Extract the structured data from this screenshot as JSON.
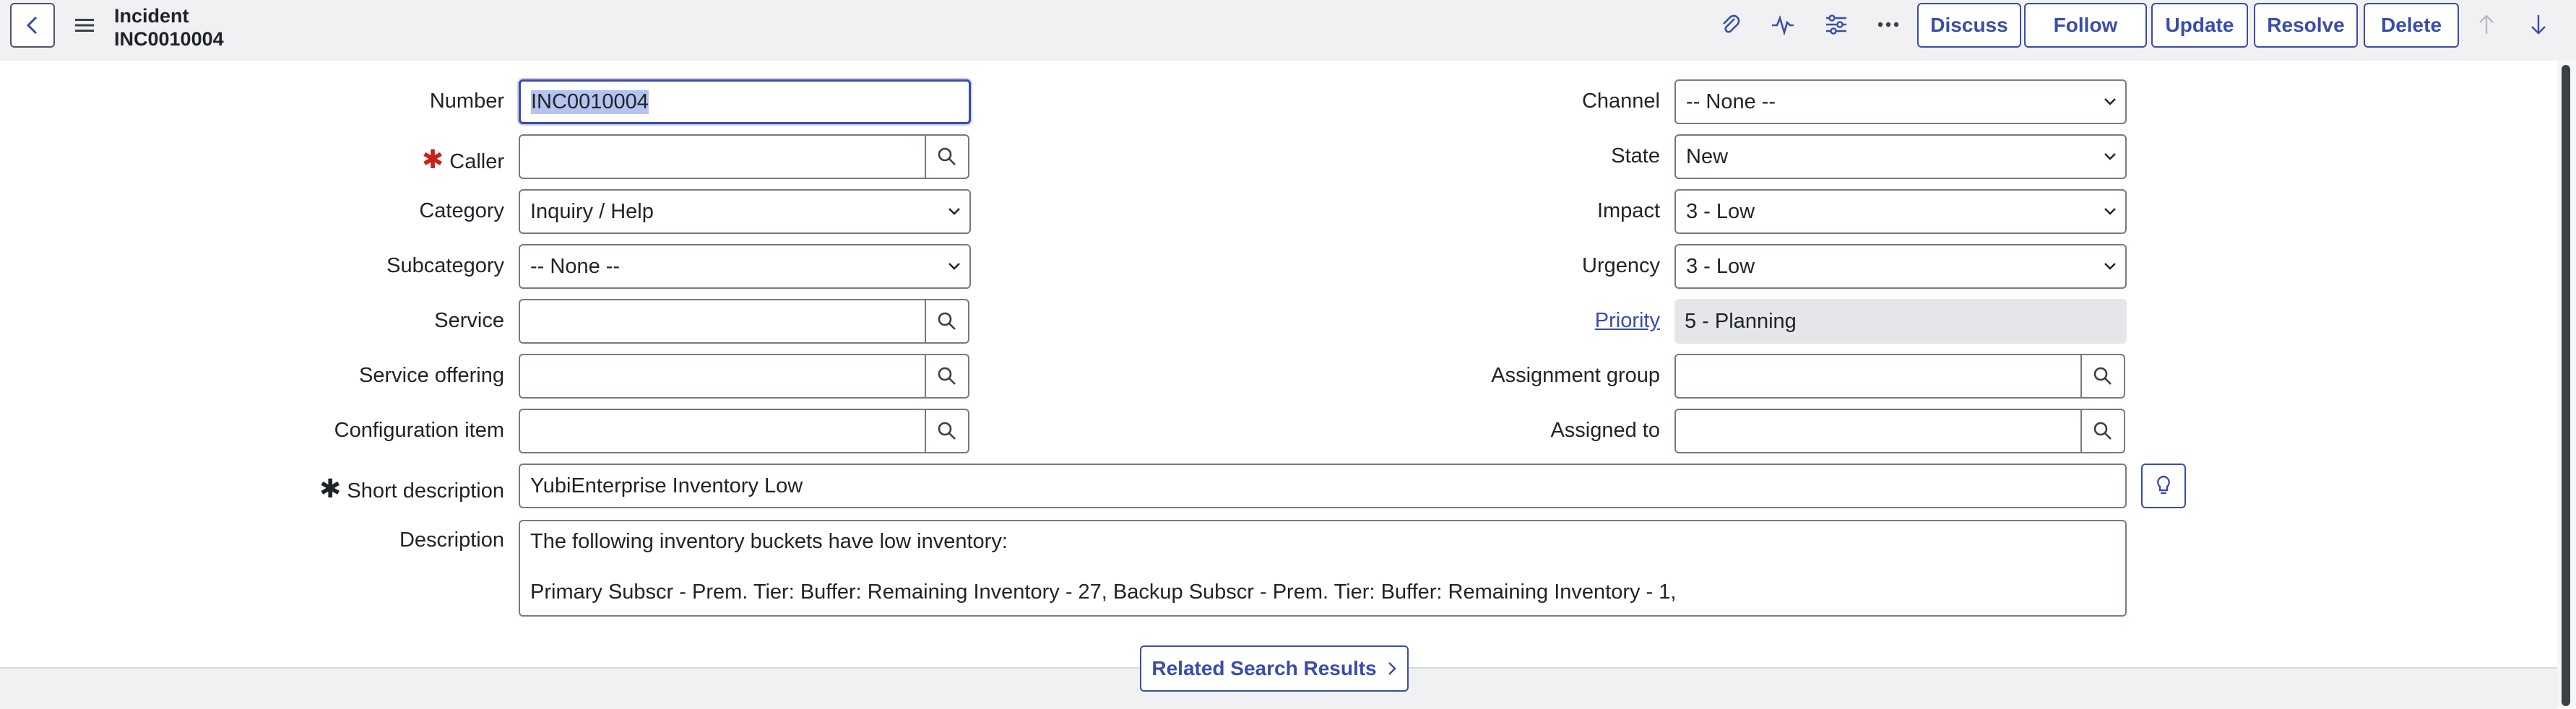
{
  "header": {
    "title": "Incident",
    "number": "INC0010004",
    "buttons": {
      "discuss": "Discuss",
      "follow": "Follow",
      "update": "Update",
      "resolve": "Resolve",
      "delete": "Delete"
    },
    "icons": [
      "back-icon",
      "hamburger-icon",
      "attachment-icon",
      "activity-icon",
      "settings-icon",
      "more-icon",
      "arrow-up-icon",
      "arrow-down-icon"
    ]
  },
  "form": {
    "left": {
      "number": {
        "label": "Number",
        "value": "INC0010004"
      },
      "caller": {
        "label": "Caller",
        "value": ""
      },
      "category": {
        "label": "Category",
        "value": "Inquiry / Help"
      },
      "subcategory": {
        "label": "Subcategory",
        "value": "-- None --"
      },
      "service": {
        "label": "Service",
        "value": ""
      },
      "service_offering": {
        "label": "Service offering",
        "value": ""
      },
      "configuration_item": {
        "label": "Configuration item",
        "value": ""
      }
    },
    "right": {
      "channel": {
        "label": "Channel",
        "value": "-- None --"
      },
      "state": {
        "label": "State",
        "value": "New"
      },
      "impact": {
        "label": "Impact",
        "value": "3 - Low"
      },
      "urgency": {
        "label": "Urgency",
        "value": "3 - Low"
      },
      "priority": {
        "label": "Priority",
        "value": "5 - Planning"
      },
      "assignment_group": {
        "label": "Assignment group",
        "value": ""
      },
      "assigned_to": {
        "label": "Assigned to",
        "value": ""
      }
    },
    "short_description": {
      "label": "Short description",
      "value": "YubiEnterprise Inventory Low"
    },
    "description": {
      "label": "Description",
      "line1": "The following inventory buckets have low inventory:",
      "line2": "Primary Subscr - Prem. Tier: Buffer: Remaining Inventory - 27, Backup Subscr - Prem. Tier: Buffer: Remaining Inventory - 1,"
    },
    "required_mark": "✱"
  },
  "footer": {
    "related_search": "Related Search Results"
  },
  "colors": {
    "accent": "#3a4cab",
    "required": "#c8201c",
    "header_bg": "#f1f1f3"
  }
}
